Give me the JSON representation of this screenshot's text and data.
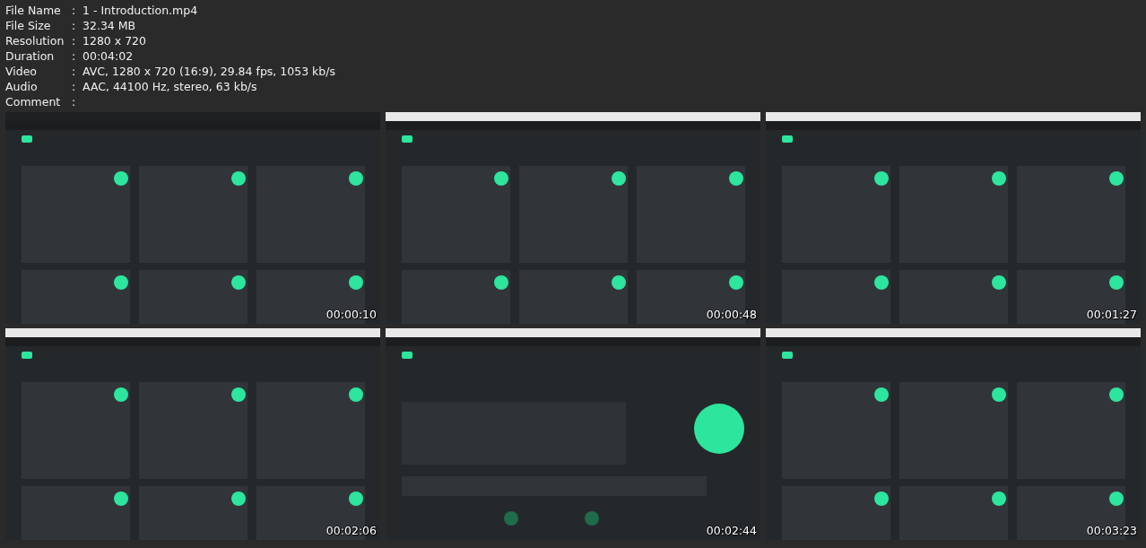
{
  "info": [
    {
      "label": "File Name",
      "value": "1 - Introduction.mp4"
    },
    {
      "label": "File Size",
      "value": "32.34 MB"
    },
    {
      "label": "Resolution",
      "value": "1280 x 720"
    },
    {
      "label": "Duration",
      "value": "00:04:02"
    },
    {
      "label": "Video",
      "value": "AVC, 1280 x 720 (16:9), 29.84 fps, 1053 kb/s"
    },
    {
      "label": "Audio",
      "value": "AAC, 44100 Hz, stereo, 63 kb/s"
    },
    {
      "label": "Comment"
    }
  ],
  "separator": ":",
  "frames": [
    {
      "kind": "picture",
      "timestamp": "00:00:10"
    },
    {
      "kind": "picture",
      "timestamp": "00:00:48"
    },
    {
      "kind": "picture",
      "timestamp": "00:01:27"
    },
    {
      "kind": "picture",
      "timestamp": "00:02:06"
    },
    {
      "kind": "picture",
      "timestamp": "00:02:44"
    },
    {
      "kind": "picture",
      "timestamp": "00:03:23"
    }
  ]
}
